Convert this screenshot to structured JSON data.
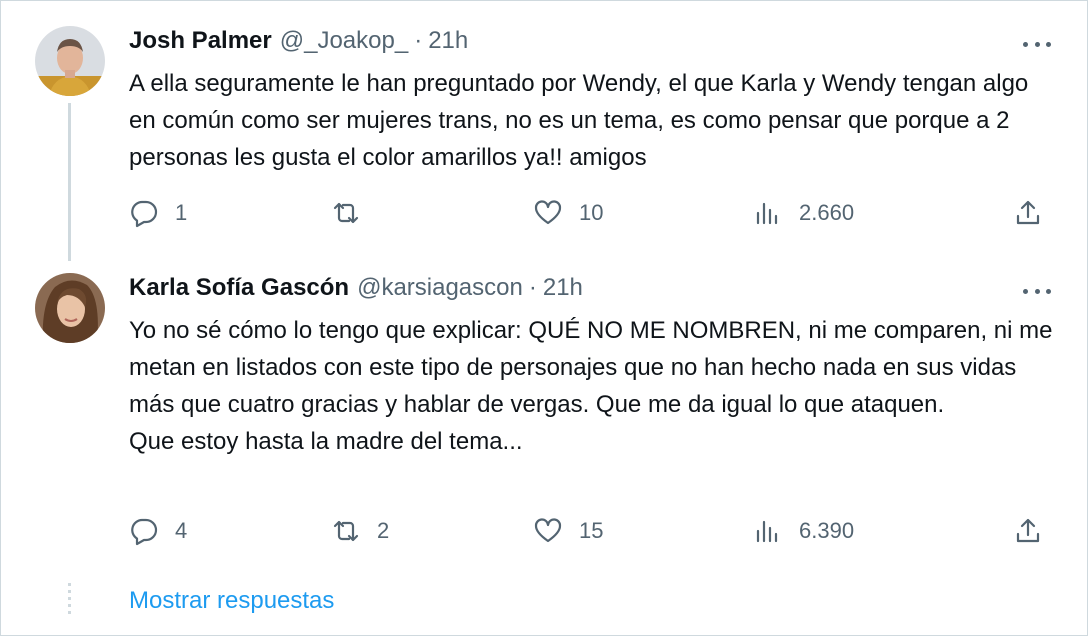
{
  "tweets": [
    {
      "name": "Josh Palmer",
      "handle": "@_Joakop_",
      "separator": "·",
      "time": "21h",
      "text": "A ella seguramente le han preguntado por Wendy, el que Karla y Wendy tengan algo en común como ser mujeres trans, no es un tema, es como pensar que porque a 2 personas les gusta el color amarillos ya!! amigos",
      "replies": "1",
      "retweets": "",
      "likes": "10",
      "views": "2.660"
    },
    {
      "name": "Karla Sofía Gascón",
      "handle": "@karsiagascon",
      "separator": "·",
      "time": "21h",
      "text": "Yo no sé cómo lo tengo que explicar: QUÉ NO ME NOMBREN, ni me comparen, ni me metan en listados con este tipo de personajes que no han hecho nada en sus vidas más que cuatro gracias y hablar de vergas. Que me da igual lo que ataquen.\nQue estoy hasta la madre del tema...",
      "replies": "4",
      "retweets": "2",
      "likes": "15",
      "views": "6.390"
    }
  ],
  "show_replies_label": "Mostrar respuestas",
  "icons": [
    "more-icon",
    "reply-icon",
    "retweet-icon",
    "like-icon",
    "views-icon",
    "share-icon"
  ],
  "colors": {
    "link": "#1d9bf0",
    "muted": "#536471",
    "text": "#0f1419",
    "border": "#cfd9de"
  }
}
